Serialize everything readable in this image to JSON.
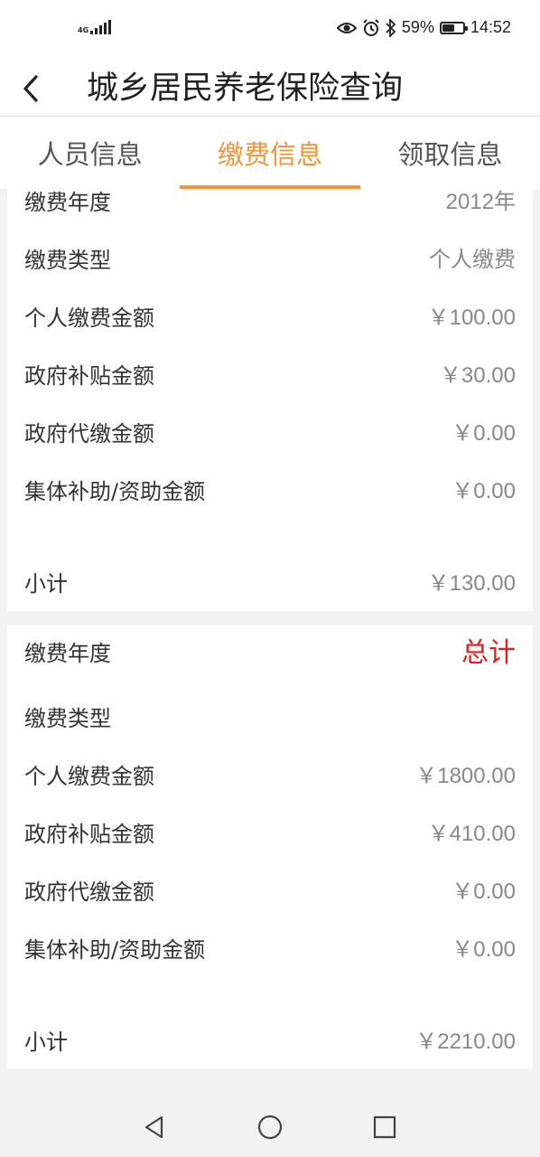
{
  "status_bar": {
    "network": "4G",
    "battery_percent": "59%",
    "battery_level": 0.59,
    "time": "14:52"
  },
  "header": {
    "title": "城乡居民养老保险查询"
  },
  "tabs": [
    {
      "label": "人员信息",
      "active": false
    },
    {
      "label": "缴费信息",
      "active": true
    },
    {
      "label": "领取信息",
      "active": false
    }
  ],
  "cards": [
    {
      "rows": [
        {
          "label": "缴费年度",
          "value": "2012年"
        },
        {
          "label": "缴费类型",
          "value": "个人缴费"
        },
        {
          "label": "个人缴费金额",
          "value": "￥100.00"
        },
        {
          "label": "政府补贴金额",
          "value": "￥30.00"
        },
        {
          "label": "政府代缴金额",
          "value": "￥0.00"
        },
        {
          "label": "集体补助/资助金额",
          "value": "￥0.00"
        },
        {
          "label": "小计",
          "value": "￥130.00"
        }
      ]
    },
    {
      "rows": [
        {
          "label": "缴费年度",
          "value": "总计"
        },
        {
          "label": "缴费类型",
          "value": ""
        },
        {
          "label": "个人缴费金额",
          "value": "￥1800.00"
        },
        {
          "label": "政府补贴金额",
          "value": "￥410.00"
        },
        {
          "label": "政府代缴金额",
          "value": "￥0.00"
        },
        {
          "label": "集体补助/资助金额",
          "value": "￥0.00"
        },
        {
          "label": "小计",
          "value": "￥2210.00"
        }
      ]
    }
  ],
  "colors": {
    "accent": "#f0953a",
    "total_red": "#e02020"
  },
  "icons": {
    "back": "chevron-left-icon",
    "eye": "eye-comfort-icon",
    "alarm": "alarm-icon",
    "bluetooth": "bluetooth-icon",
    "battery": "battery-icon",
    "nav_back": "triangle-back-icon",
    "nav_home": "circle-home-icon",
    "nav_recents": "square-recents-icon"
  }
}
